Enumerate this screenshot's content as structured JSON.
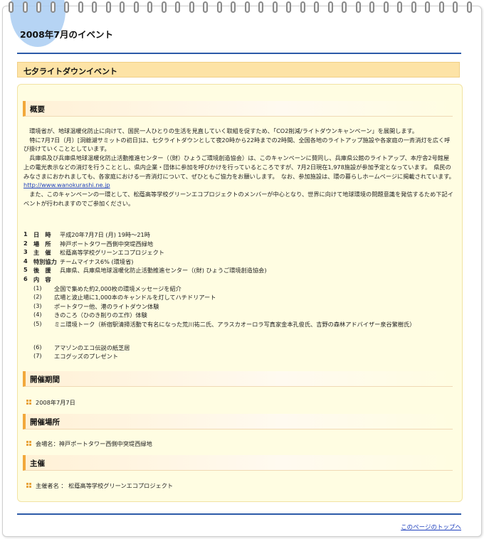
{
  "page": {
    "title": "2008年7月のイベント",
    "section_title": "七夕ライトダウンイベント"
  },
  "overview": {
    "heading": "概要",
    "p1": "環境省が、地球温暖化防止に向けて、国民一人ひとりの生活を見直していく取組を促すため、「CO2削減/ライトダウンキャンペーン」を展開します。",
    "p2": "特に7月7日（月）[洞爺湖サミットの初日]は、七夕ライトダウンとして夜20時から22時までの2時間、全国各地のライトアップ施設や各家庭の一斉消灯を広く呼び掛けていくこととしています。",
    "p3": "兵庫県及び兵庫県地球温暖化防止活動推進センター（（財）ひょうご環境創造協会）は、このキャンペーンに賛同し、兵庫県公館のライトアップ、本庁舎2号館屋上の電光表示などの消灯を行うこととし、県内企業・団体に参加を呼びかけを行っているところですが、7月2日現在1,978施設が参加予定となっています。　県民のみなさまにおかれましても、各家庭における一斉消灯について、ぜひともご協力をお願いします。　なお、参加施設は、環の暮らしホームページに掲載されています。",
    "link": "http://www.wanokurashi.ne.jp",
    "p4": "また、このキャンペーンの一環として、松蔭高等学校グリーンエコプロジェクトのメンバーが中心となり、世界に向けて地球環境の問題意識を発信するため下記イベントが行われますのでご参加ください。"
  },
  "details": [
    {
      "num": "1",
      "label": "日　時",
      "value": "平成20年7月7日 (月) 19時～21時"
    },
    {
      "num": "2",
      "label": "場　所",
      "value": "神戸ポートタワー西側中突堤西緑地"
    },
    {
      "num": "3",
      "label": "主　催",
      "value": "松蔭高等学校グリーンエコプロジェクト"
    },
    {
      "num": "4",
      "label": "特別協力",
      "value": "チームマイナス6% (環境省)"
    },
    {
      "num": "5",
      "label": "後　援",
      "value": "兵庫県、兵庫県地球温暖化防止活動推進センター（(財) ひょうご環境創造協会)"
    },
    {
      "num": "6",
      "label": "内　容",
      "value": ""
    }
  ],
  "contents": [
    {
      "num": "(1)",
      "text": "全国で集めた約2,000枚の環境メッセージを紹介"
    },
    {
      "num": "(2)",
      "text": "広場と波止場に1,000本のキャンドルを灯してハチドリアート"
    },
    {
      "num": "(3)",
      "text": "ポートタワー他、港のライトダウン体験"
    },
    {
      "num": "(4)",
      "text": "きのころ（ひのき削りの工作）体験"
    },
    {
      "num": "(5)",
      "text": "ミニ環境トーク（新宿駅清掃活動で有名になった荒川祐二氏、アラスカオーロラ写真家金本孔俊氏、吉野の森林アドバイザー泉谷繁樹氏）"
    },
    {
      "num": "(6)",
      "text": "アマゾンのエコ伝説の紙芝居"
    },
    {
      "num": "(7)",
      "text": "エコグッズのプレゼント"
    }
  ],
  "period": {
    "heading": "開催期間",
    "value": "2008年7月7日"
  },
  "venue": {
    "heading": "開催場所",
    "value": "会場名：神戸ポートタワー西側中突堤西緑地"
  },
  "organizer": {
    "heading": "主催",
    "value": "主催者名 ： 松蔭高等学校グリーンエコプロジェクト"
  },
  "footer": {
    "top_link": "このページのトップへ"
  },
  "colors": {
    "accent_blue": "#2c5aa8",
    "band": "#fde3a6",
    "panel": "#fffde2",
    "bullet": "#e8a33a"
  }
}
